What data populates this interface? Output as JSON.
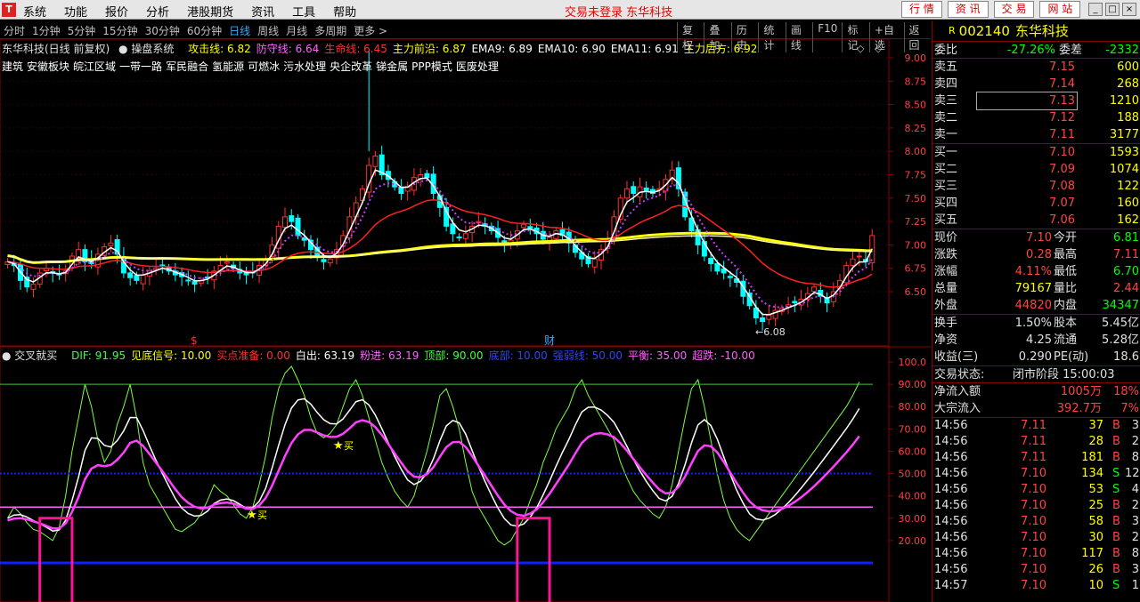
{
  "app": {
    "menu": [
      "系统",
      "功能",
      "报价",
      "分析",
      "港股期货",
      "资讯",
      "工具",
      "帮助"
    ],
    "status_text": "交易未登录 东华科技",
    "top_buttons": [
      "行 情",
      "资 讯",
      "交 易",
      "网 站"
    ],
    "window_buttons": [
      "_",
      "□",
      "×"
    ]
  },
  "periods": [
    "分时",
    "1分钟",
    "5分钟",
    "15分钟",
    "30分钟",
    "60分钟",
    "日线",
    "周线",
    "月线",
    "多周期",
    "更多 >"
  ],
  "active_period": "日线",
  "chart_tools": [
    "复权",
    "叠加",
    "历史",
    "统计",
    "画线",
    "F10",
    "标记",
    "+自选",
    "返回"
  ],
  "main_header": {
    "stock": "东华科技(日线 前复权)",
    "system": "操盘系统",
    "items": [
      {
        "label": "攻击线: 6.82",
        "color": "#ffff00"
      },
      {
        "label": "防守线: 6.64",
        "color": "#ff60ff"
      },
      {
        "label": "生命线: 6.45",
        "color": "#ff3030"
      },
      {
        "label": "主力前沿: 6.87",
        "color": "#ffff00"
      },
      {
        "label": "EMA9: 6.89",
        "color": "#ffffff"
      },
      {
        "label": "EMA10: 6.90",
        "color": "#ffffff"
      },
      {
        "label": "EMA11: 6.91",
        "color": "#ffffff"
      },
      {
        "label": "主力后方: 6.92",
        "color": "#ffff00"
      }
    ]
  },
  "concepts": [
    "建筑",
    "安徽板块",
    "皖江区域",
    "一带一路",
    "军民融合",
    "氢能源",
    "可燃冰",
    "污水处理",
    "央企改革",
    "锑金属",
    "PPP模式",
    "医废处理"
  ],
  "markers": {
    "s_label": "$",
    "cai_label": "财",
    "low_label": "←6.08",
    "buy_label": "买"
  },
  "sub_header": {
    "name": "交叉就买",
    "items": [
      {
        "label": "DIF: 91.95",
        "color": "#40ff40"
      },
      {
        "label": "见底信号: 10.00",
        "color": "#ffff00"
      },
      {
        "label": "买点准备: 0.00",
        "color": "#ff3030"
      },
      {
        "label": "白出: 63.19",
        "color": "#ffffff"
      },
      {
        "label": "粉进: 63.19",
        "color": "#ff60ff"
      },
      {
        "label": "顶部: 90.00",
        "color": "#40ff40"
      },
      {
        "label": "底部: 10.00",
        "color": "#3040ff"
      },
      {
        "label": "强弱线: 50.00",
        "color": "#3040ff"
      },
      {
        "label": "平衡: 35.00",
        "color": "#ff60ff"
      },
      {
        "label": "超跌: -10.00",
        "color": "#ff60ff"
      }
    ]
  },
  "price_axis": [
    "9.00",
    "8.75",
    "8.50",
    "8.25",
    "8.00",
    "7.75",
    "7.50",
    "7.25",
    "7.00",
    "6.75",
    "6.50"
  ],
  "osc_axis": [
    "100.0",
    "90.00",
    "80.00",
    "70.00",
    "60.00",
    "50.00",
    "40.00",
    "30.00",
    "20.00"
  ],
  "quote": {
    "code": "002140",
    "name": "东华科技",
    "r_label": "R",
    "weibi_label": "委比",
    "weibi": "-27.26%",
    "weicha_label": "委差",
    "weicha": "-2332",
    "asks": [
      {
        "label": "卖五",
        "price": "7.15",
        "vol": "600"
      },
      {
        "label": "卖四",
        "price": "7.14",
        "vol": "268"
      },
      {
        "label": "卖三",
        "price": "7.13",
        "vol": "1210"
      },
      {
        "label": "卖二",
        "price": "7.12",
        "vol": "188"
      },
      {
        "label": "卖一",
        "price": "7.11",
        "vol": "3177"
      }
    ],
    "bids": [
      {
        "label": "买一",
        "price": "7.10",
        "vol": "1593"
      },
      {
        "label": "买二",
        "price": "7.09",
        "vol": "1074"
      },
      {
        "label": "买三",
        "price": "7.08",
        "vol": "122"
      },
      {
        "label": "买四",
        "price": "7.07",
        "vol": "160"
      },
      {
        "label": "买五",
        "price": "7.06",
        "vol": "162"
      }
    ],
    "stats": [
      {
        "l1": "现价",
        "v1": "7.10",
        "c1": "red",
        "l2": "今开",
        "v2": "6.81",
        "c2": "green"
      },
      {
        "l1": "涨跌",
        "v1": "0.28",
        "c1": "red",
        "l2": "最高",
        "v2": "7.11",
        "c2": "red"
      },
      {
        "l1": "涨幅",
        "v1": "4.11%",
        "c1": "red",
        "l2": "最低",
        "v2": "6.70",
        "c2": "green"
      },
      {
        "l1": "总量",
        "v1": "79167",
        "c1": "yellow",
        "l2": "量比",
        "v2": "2.44",
        "c2": "red"
      },
      {
        "l1": "外盘",
        "v1": "44820",
        "c1": "red",
        "l2": "内盘",
        "v2": "34347",
        "c2": "green"
      }
    ],
    "stats2": [
      {
        "l1": "换手",
        "v1": "1.50%",
        "c1": "white",
        "l2": "股本",
        "v2": "5.45亿",
        "c2": "white"
      },
      {
        "l1": "净资",
        "v1": "4.25",
        "c1": "white",
        "l2": "流通",
        "v2": "5.28亿",
        "c2": "white"
      },
      {
        "l1": "收益(三)",
        "v1": "0.290",
        "c1": "white",
        "l2": "PE(动)",
        "v2": "18.6",
        "c2": "white"
      }
    ],
    "trade_state_label": "交易状态:",
    "trade_state": "闭市阶段 15:00:03",
    "flows": [
      {
        "label": "净流入额",
        "value": "1005万",
        "pct": "18%"
      },
      {
        "label": "大宗流入",
        "value": "392.7万",
        "pct": "7%"
      }
    ],
    "ticks": [
      {
        "t": "14:56",
        "p": "7.11",
        "v": "37",
        "s": "B",
        "n": "3"
      },
      {
        "t": "14:56",
        "p": "7.11",
        "v": "28",
        "s": "B",
        "n": "2"
      },
      {
        "t": "14:56",
        "p": "7.11",
        "v": "181",
        "s": "B",
        "n": "8"
      },
      {
        "t": "14:56",
        "p": "7.10",
        "v": "134",
        "s": "S",
        "n": "12"
      },
      {
        "t": "14:56",
        "p": "7.10",
        "v": "53",
        "s": "S",
        "n": "4"
      },
      {
        "t": "14:56",
        "p": "7.10",
        "v": "25",
        "s": "B",
        "n": "2"
      },
      {
        "t": "14:56",
        "p": "7.10",
        "v": "58",
        "s": "B",
        "n": "3"
      },
      {
        "t": "14:56",
        "p": "7.10",
        "v": "30",
        "s": "B",
        "n": "2"
      },
      {
        "t": "14:56",
        "p": "7.10",
        "v": "117",
        "s": "B",
        "n": "8"
      },
      {
        "t": "14:56",
        "p": "7.10",
        "v": "26",
        "s": "B",
        "n": "3"
      },
      {
        "t": "14:57",
        "p": "7.10",
        "v": "10",
        "s": "S",
        "n": "1"
      }
    ]
  },
  "colors": {
    "up": "#ff3030",
    "down": "#00ffff",
    "border": "#880000",
    "yellow": "#ffff00",
    "pink": "#ff40ff",
    "magenta": "#ff1493",
    "green": "#80ff40",
    "blue": "#1020ff"
  },
  "price_series": {
    "close": [
      6.82,
      6.78,
      6.62,
      6.55,
      6.58,
      6.7,
      6.75,
      6.7,
      6.68,
      6.72,
      6.88,
      6.95,
      6.82,
      6.8,
      6.9,
      6.98,
      7.02,
      6.9,
      6.7,
      6.65,
      6.62,
      6.68,
      6.72,
      6.75,
      6.78,
      6.72,
      6.68,
      6.66,
      6.62,
      6.58,
      6.62,
      6.65,
      6.72,
      6.78,
      6.82,
      6.75,
      6.7,
      6.68,
      6.7,
      6.78,
      6.85,
      7.0,
      7.2,
      7.3,
      7.25,
      7.1,
      7.05,
      6.95,
      6.88,
      6.82,
      6.85,
      6.95,
      7.1,
      7.3,
      7.45,
      7.6,
      7.85,
      7.95,
      7.75,
      7.7,
      7.62,
      7.55,
      7.62,
      7.72,
      7.75,
      7.72,
      7.55,
      7.4,
      7.2,
      7.12,
      7.08,
      7.12,
      7.2,
      7.25,
      7.2,
      7.15,
      7.08,
      7.02,
      7.05,
      7.15,
      7.22,
      7.18,
      7.12,
      7.06,
      7.08,
      7.15,
      7.1,
      7.02,
      6.92,
      6.85,
      6.8,
      6.85,
      6.95,
      7.05,
      7.3,
      7.5,
      7.6,
      7.55,
      7.62,
      7.58,
      7.55,
      7.6,
      7.7,
      7.8,
      7.6,
      7.3,
      7.15,
      7.0,
      6.88,
      6.8,
      6.72,
      6.7,
      6.65,
      6.6,
      6.45,
      6.35,
      6.22,
      6.18,
      6.25,
      6.3,
      6.32,
      6.36,
      6.38,
      6.42,
      6.48,
      6.55,
      6.45,
      6.38,
      6.5,
      6.62,
      6.78,
      6.85,
      6.88,
      6.82,
      7.1
    ]
  },
  "osc_series": {
    "dif": [
      30,
      35,
      32,
      28,
      25,
      24,
      22,
      20,
      26,
      40,
      60,
      75,
      90,
      80,
      65,
      55,
      60,
      72,
      80,
      90,
      75,
      55,
      45,
      40,
      35,
      30,
      25,
      24,
      26,
      28,
      32,
      38,
      45,
      42,
      40,
      36,
      32,
      30,
      35,
      45,
      58,
      75,
      88,
      95,
      98,
      92,
      85,
      75,
      68,
      66,
      68,
      72,
      80,
      88,
      92,
      85,
      75,
      65,
      55,
      48,
      42,
      38,
      35,
      40,
      50,
      60,
      72,
      85,
      88,
      80,
      70,
      55,
      42,
      35,
      30,
      25,
      20,
      18,
      20,
      25,
      30,
      38,
      45,
      55,
      62,
      70,
      75,
      80,
      88,
      92,
      85,
      80,
      75,
      70,
      65,
      55,
      48,
      42,
      38,
      35,
      32,
      30,
      35,
      45,
      60,
      75,
      88,
      92,
      80,
      65,
      50,
      38,
      30,
      25,
      22,
      20,
      24,
      28,
      32,
      36,
      40,
      44,
      48,
      52,
      56,
      60,
      64,
      68,
      72,
      76,
      80,
      85,
      91
    ]
  }
}
